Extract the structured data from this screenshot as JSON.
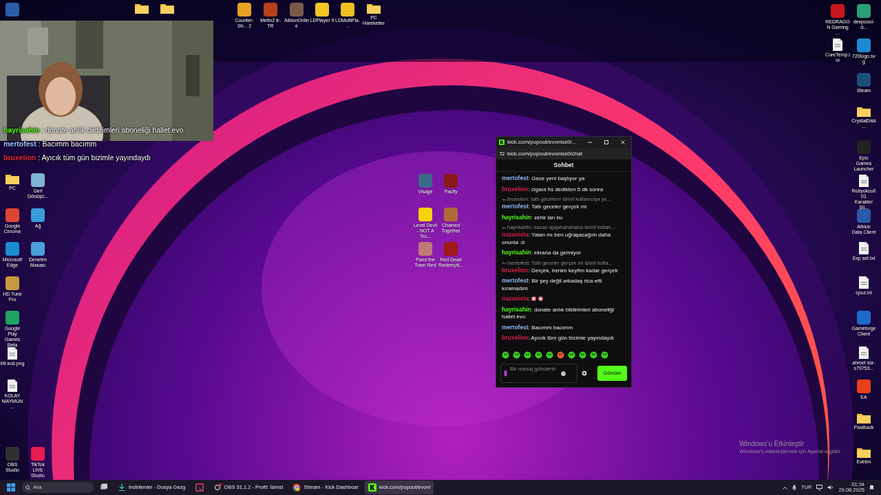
{
  "desktop_icons": {
    "top": [
      {
        "kind": "app",
        "color": "#2b5fa8"
      },
      {
        "kind": "folder"
      },
      {
        "kind": "folder"
      },
      {
        "kind": "app",
        "color": "#e8a020",
        "label": "Counter-Str... 2"
      },
      {
        "kind": "app",
        "color": "#b8401a",
        "label": "Metin2 tr-TR"
      },
      {
        "kind": "app",
        "color": "#7a5a4a",
        "label": "AlbionOnline"
      },
      {
        "kind": "app",
        "color": "#f3c623",
        "label": "LDPlayer 9"
      },
      {
        "kind": "app",
        "color": "#f0c020",
        "label": "LDMultiPla..."
      },
      {
        "kind": "folder",
        "label": "PC Hareketler"
      }
    ],
    "left": [
      {
        "kind": "folder",
        "label": "PC"
      },
      {
        "kind": "app",
        "color": "#7fb6d8",
        "label": "Geri Dönüşü..."
      },
      {
        "kind": "app",
        "color": "#e04437",
        "label": "Google Chrome"
      },
      {
        "kind": "app",
        "color": "#3a9bd8",
        "label": "Ağ"
      },
      {
        "kind": "app",
        "color": "#1c8ad0",
        "label": "Microsoft Edge"
      },
      {
        "kind": "app",
        "color": "#4aa0d8",
        "label": "Denetim Masası"
      },
      {
        "kind": "app",
        "color": "#c89a40",
        "label": "HD Tune Pro"
      },
      {
        "kind": "app",
        "color": "#1fa463",
        "label": "Google Play Games Beta"
      },
      {
        "kind": "file",
        "label": "btt kod.png"
      },
      {
        "kind": "file",
        "label": "KOLAY MAYMUN ..."
      },
      {
        "kind": "app",
        "color": "#303030",
        "label": "OBS Studio"
      },
      {
        "kind": "app",
        "color": "#e81c4f",
        "label": "TikTok LIVE Studio"
      }
    ],
    "middle": [
      {
        "kind": "app",
        "color": "#3a6a8a",
        "label": "Visage"
      },
      {
        "kind": "app",
        "color": "#8a1a1a",
        "label": "Pacify"
      },
      {
        "kind": "app",
        "color": "#f5d20a",
        "label": "Level Devil - NOT A Tro..."
      },
      {
        "kind": "app",
        "color": "#b06a3a",
        "label": "Chained Together"
      },
      {
        "kind": "app",
        "color": "#c07a7a",
        "label": "Paint the Town Red"
      },
      {
        "kind": "app",
        "color": "#a01818",
        "label": "Red Dead Redempti..."
      }
    ],
    "right": [
      {
        "kind": "app",
        "color": "#c8161e",
        "label": "REDRAGON Gaming ..."
      },
      {
        "kind": "app",
        "color": "#2aa07a",
        "label": "deepcool-d..."
      },
      {
        "kind": "file",
        "label": "CoreTemp.ini"
      },
      {
        "kind": "app",
        "color": "#1c8ad0",
        "label": "720logo.svg"
      },
      {
        "kind": "app",
        "color": "#1b4f7a",
        "label": "Steam"
      },
      {
        "kind": "folder",
        "label": "CrystalDisk..."
      },
      {
        "kind": "app",
        "color": "#222222",
        "label": "Epic Games Launcher"
      },
      {
        "kind": "file",
        "label": "Rubyokcu001 Karakter Sil..."
      },
      {
        "kind": "app",
        "color": "#2a5aa8",
        "label": "Albion Data Client"
      },
      {
        "kind": "file",
        "label": "Exp set.txt"
      },
      {
        "kind": "file",
        "label": "cpuz.ini"
      },
      {
        "kind": "app",
        "color": "#1e6ac8",
        "label": "Gameforge Client"
      },
      {
        "kind": "file",
        "label": "ahmet sür-s79753..."
      },
      {
        "kind": "app",
        "color": "#e8401a",
        "label": "EA"
      },
      {
        "kind": "folder",
        "label": "Pastback"
      },
      {
        "kind": "folder",
        "label": "Evinim"
      }
    ]
  },
  "stream_overlay": {
    "kind": "picture",
    "chat": [
      {
        "user": "hayrisahin",
        "color": "#53fc18",
        "text": " : donate anlık bildirimleri aboneliği hallet evo"
      },
      {
        "user": "mertofest",
        "color": "#9ec6ff",
        "text": " : Bacımm bacımm"
      },
      {
        "user": "bruxelion",
        "color": "#e8283c",
        "text": " : Ayıcık tüm gün bizimle yayındaydı"
      }
    ]
  },
  "chat_window": {
    "title": "kick.com/popout/evoniss0/...",
    "address": "kick.com/popout/evoniss0/chat",
    "header": "Sohbet",
    "messages": [
      {
        "kind": "message",
        "user": "mertofest",
        "color": "#8fb4ec",
        "text": ": Gece yeni başlıyor ya"
      },
      {
        "kind": "message",
        "user": "bruxelion",
        "color": "#d81e4a",
        "text": ": cigara fıs dedikten 5 dk sonra"
      },
      {
        "kind": "reply",
        "text": "bruxelion: tatlı gecelerrr isimli kullanıcıya ye..."
      },
      {
        "kind": "message",
        "user": "mertofest",
        "color": "#8fb4ec",
        "text": ": Tatlı geceler gerçek mi"
      },
      {
        "kind": "message",
        "user": "hayrisahin",
        "color": "#53fc18",
        "text": ": zehir lan bu"
      },
      {
        "kind": "reply",
        "text": "hayrisahin: nazan ajajahahahaha isimli kullan..."
      },
      {
        "kind": "message",
        "user": "nazanista",
        "color": "#d81e4a",
        "text": ": Yalan mı ben uğraşacağım daha onunla :d"
      },
      {
        "kind": "message",
        "user": "hayrisahin",
        "color": "#53fc18",
        "text": ": ekrana da gelmiyor"
      },
      {
        "kind": "reply",
        "text": "mertofest: Tatlı geceler gerçek mi isimli kulla..."
      },
      {
        "kind": "message",
        "user": "bruxelion",
        "color": "#d81e4a",
        "text": ": Gerçek, benim keyfim kadar gerçek"
      },
      {
        "kind": "message",
        "user": "mertofest",
        "color": "#8fb4ec",
        "text": ": Bir şey değil arkadaş rica etti kıramadım"
      },
      {
        "kind": "emotes",
        "user": "nazanista",
        "color": "#d81e4a",
        "text": ":"
      },
      {
        "kind": "message",
        "user": "hayrisahin",
        "color": "#53fc18",
        "text": ": donate anlık bildirimleri aboneliği hallet evo"
      },
      {
        "kind": "message",
        "user": "mertofest",
        "color": "#8fb4ec",
        "text": ": Bacımm bacımm"
      },
      {
        "kind": "message",
        "user": "bruxelion",
        "color": "#d81e4a",
        "text": ": Ayıcık tüm gün bizimle yayındaydı"
      }
    ],
    "input": {
      "placeholder": "Bir mesaj gönderin"
    },
    "send_button": "Gönder"
  },
  "activation": {
    "title": "Windows'u Etkinleştir",
    "text": "Windows'u etkinleştirmek için Ayarlar'a gidin."
  },
  "taskbar": {
    "search": "Ara",
    "items": [
      {
        "kind": "taskview",
        "selected": false
      },
      {
        "kind": "download",
        "label": "İndirilenler - Dosya Gezg",
        "selected": false
      },
      {
        "kind": "snip",
        "selected": false
      },
      {
        "kind": "obs",
        "label": "OBS 31.1.2 - Profil: İsimsi",
        "selected": false
      },
      {
        "kind": "chrome",
        "label": "Stream - Kick Dashboar",
        "selected": false
      },
      {
        "kind": "kick",
        "label": "kick.com/popout/evoni",
        "selected": true
      }
    ],
    "language": "TUR",
    "time": "01:34",
    "date": "29.08.2025"
  }
}
